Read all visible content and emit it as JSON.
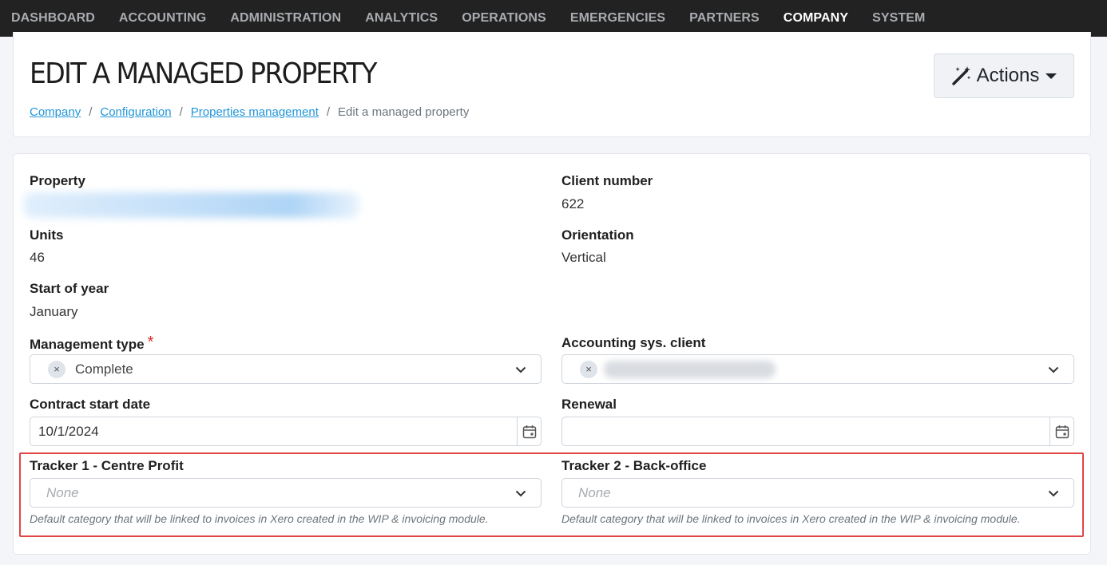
{
  "nav": {
    "items": [
      {
        "label": "DASHBOARD"
      },
      {
        "label": "ACCOUNTING"
      },
      {
        "label": "ADMINISTRATION"
      },
      {
        "label": "ANALYTICS"
      },
      {
        "label": "OPERATIONS"
      },
      {
        "label": "EMERGENCIES"
      },
      {
        "label": "PARTNERS"
      },
      {
        "label": "COMPANY",
        "active": true
      },
      {
        "label": "SYSTEM"
      }
    ]
  },
  "header": {
    "title": "EDIT A MANAGED PROPERTY",
    "actions_label": "Actions",
    "actions_icon": "magic-wand-icon",
    "breadcrumb": {
      "items": [
        "Company",
        "Configuration",
        "Properties management"
      ],
      "current": "Edit a managed property",
      "separator": "/"
    }
  },
  "form": {
    "property": {
      "label": "Property"
    },
    "client_number": {
      "label": "Client number",
      "value": "622"
    },
    "units": {
      "label": "Units",
      "value": "46"
    },
    "orientation": {
      "label": "Orientation",
      "value": "Vertical"
    },
    "start_of_year": {
      "label": "Start of year",
      "value": "January"
    },
    "management_type": {
      "label": "Management type",
      "required_mark": "*",
      "value": "Complete"
    },
    "accounting_client": {
      "label": "Accounting sys. client"
    },
    "contract_start": {
      "label": "Contract start date",
      "value": "10/1/2024"
    },
    "renewal": {
      "label": "Renewal",
      "value": ""
    },
    "tracker1": {
      "label": "Tracker 1 - Centre Profit",
      "placeholder": "None",
      "help": "Default category that will be linked to invoices in Xero created in the WIP & invoicing module."
    },
    "tracker2": {
      "label": "Tracker 2 - Back-office",
      "placeholder": "None",
      "help": "Default category that will be linked to invoices in Xero created in the WIP & invoicing module."
    }
  },
  "colors": {
    "nav_bg": "#222222",
    "link": "#2196d8",
    "required": "#e02424",
    "highlight": "#e04646"
  },
  "chip_remove_symbol": "×"
}
